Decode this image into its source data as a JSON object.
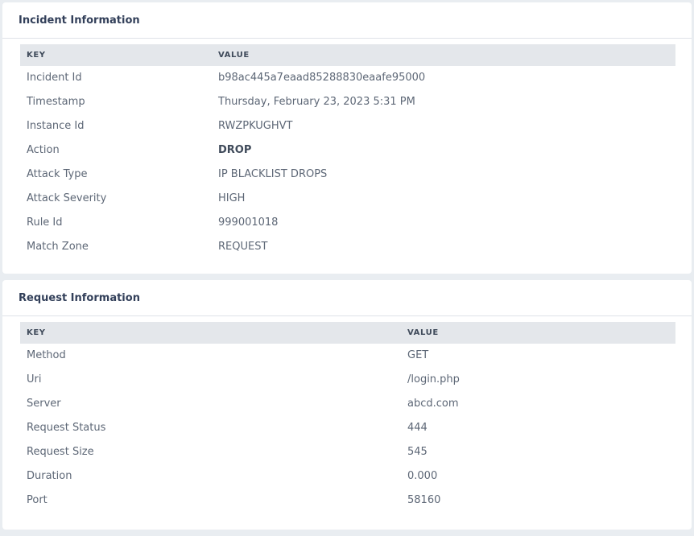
{
  "incident": {
    "title": "Incident Information",
    "header": {
      "key": "KEY",
      "value": "VALUE"
    },
    "rows": [
      {
        "key": "Incident Id",
        "value": "b98ac445a7eaad85288830eaafe95000"
      },
      {
        "key": "Timestamp",
        "value": "Thursday, February 23, 2023 5:31 PM"
      },
      {
        "key": "Instance Id",
        "value": "RWZPKUGHVT"
      },
      {
        "key": "Action",
        "value": "DROP"
      },
      {
        "key": "Attack Type",
        "value": "IP BLACKLIST DROPS"
      },
      {
        "key": "Attack Severity",
        "value": "HIGH"
      },
      {
        "key": "Rule Id",
        "value": "999001018"
      },
      {
        "key": "Match Zone",
        "value": "REQUEST"
      }
    ]
  },
  "request": {
    "title": "Request Information",
    "header": {
      "key": "KEY",
      "value": "VALUE"
    },
    "rows": [
      {
        "key": "Method",
        "value": "GET"
      },
      {
        "key": "Uri",
        "value": "/login.php"
      },
      {
        "key": "Server",
        "value": "abcd.com"
      },
      {
        "key": "Request Status",
        "value": "444"
      },
      {
        "key": "Request Size",
        "value": "545"
      },
      {
        "key": "Duration",
        "value": "0.000"
      },
      {
        "key": "Port",
        "value": "58160"
      }
    ]
  }
}
